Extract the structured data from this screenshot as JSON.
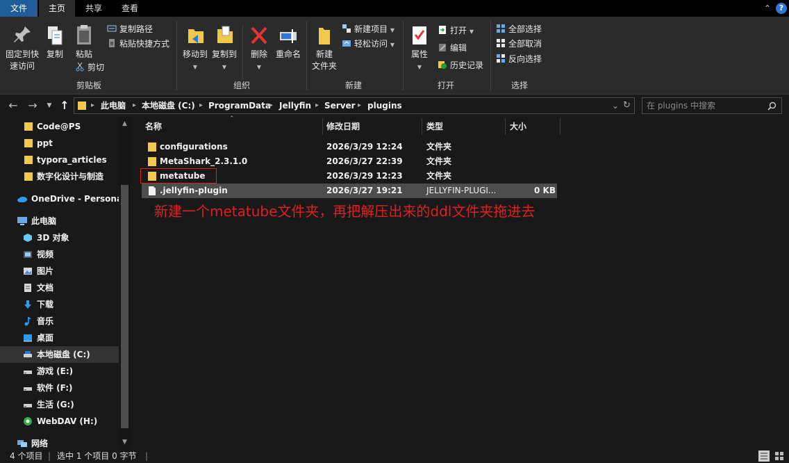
{
  "tabs": {
    "file": "文件",
    "home": "主页",
    "share": "共享",
    "view": "查看"
  },
  "ribbon": {
    "clipboard": {
      "pin": "固定到快\n速访问",
      "pin_line1": "固定到快",
      "pin_line2": "速访问",
      "copy": "复制",
      "paste": "粘贴",
      "copy_path": "复制路径",
      "paste_shortcut": "粘贴快捷方式",
      "cut": "剪切",
      "label": "剪贴板"
    },
    "organize": {
      "move_to": "移动到",
      "copy_to": "复制到",
      "delete": "删除",
      "rename": "重命名",
      "label": "组织"
    },
    "new": {
      "new_folder_line1": "新建",
      "new_folder_line2": "文件夹",
      "new_item": "新建项目",
      "easy_access": "轻松访问",
      "label": "新建"
    },
    "open": {
      "properties": "属性",
      "open": "打开",
      "edit": "编辑",
      "history": "历史记录",
      "label": "打开"
    },
    "select": {
      "select_all": "全部选择",
      "select_none": "全部取消",
      "invert": "反向选择",
      "label": "选择"
    }
  },
  "address": {
    "crumbs": [
      "此电脑",
      "本地磁盘 (C:)",
      "ProgramData",
      "Jellyfin",
      "Server",
      "plugins"
    ],
    "search_placeholder": "在 plugins 中搜索"
  },
  "sidebar": {
    "items": [
      {
        "label": "Code@PS",
        "icon": "folder-icon"
      },
      {
        "label": "ppt",
        "icon": "folder-icon"
      },
      {
        "label": "typora_articles",
        "icon": "folder-icon"
      },
      {
        "label": "数字化设计与制造",
        "icon": "folder-icon"
      },
      {
        "label": "OneDrive - Personal",
        "icon": "cloud-icon"
      },
      {
        "label": "此电脑",
        "icon": "computer-icon"
      },
      {
        "label": "3D 对象",
        "icon": "cube-icon"
      },
      {
        "label": "视频",
        "icon": "video-icon"
      },
      {
        "label": "图片",
        "icon": "picture-icon"
      },
      {
        "label": "文档",
        "icon": "document-icon"
      },
      {
        "label": "下载",
        "icon": "download-icon"
      },
      {
        "label": "音乐",
        "icon": "music-icon"
      },
      {
        "label": "桌面",
        "icon": "desktop-icon"
      },
      {
        "label": "本地磁盘 (C:)",
        "icon": "drive-icon"
      },
      {
        "label": "游戏 (E:)",
        "icon": "drive-icon"
      },
      {
        "label": "软件 (F:)",
        "icon": "drive-icon"
      },
      {
        "label": "生活 (G:)",
        "icon": "drive-icon"
      },
      {
        "label": "WebDAV (H:)",
        "icon": "network-drive-icon"
      },
      {
        "label": "网络",
        "icon": "network-icon"
      }
    ]
  },
  "file_list": {
    "columns": {
      "name": "名称",
      "date": "修改日期",
      "type": "类型",
      "size": "大小"
    },
    "rows": [
      {
        "name": "configurations",
        "date": "2026/3/29 12:24",
        "type": "文件夹",
        "size": "",
        "icon": "folder-icon"
      },
      {
        "name": "MetaShark_2.3.1.0",
        "date": "2026/3/27 22:39",
        "type": "文件夹",
        "size": "",
        "icon": "folder-icon"
      },
      {
        "name": "metatube",
        "date": "2026/3/29 12:23",
        "type": "文件夹",
        "size": "",
        "icon": "folder-icon"
      },
      {
        "name": ".jellyfin-plugin",
        "date": "2026/3/27 19:21",
        "type": "JELLYFIN-PLUGI...",
        "size": "0 KB",
        "icon": "file-icon"
      }
    ],
    "annotation": "新建一个metatube文件夹，再把解压出来的ddl文件夹拖进去"
  },
  "status": {
    "count": "4 个项目",
    "selected": "选中 1 个项目  0 字节"
  },
  "colors": {
    "accent": "#1f5c99",
    "folder": "#f0c84a",
    "annotation": "#e02020"
  }
}
